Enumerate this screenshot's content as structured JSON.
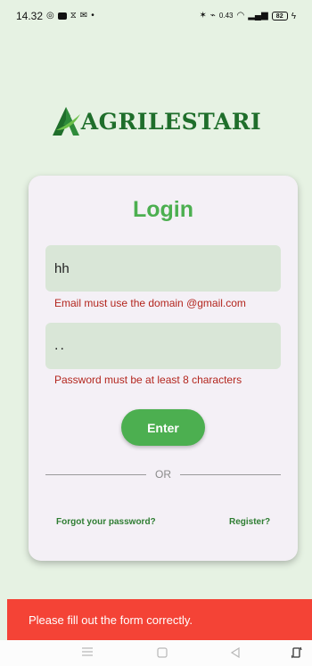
{
  "status_bar": {
    "time": "14.32",
    "net_speed": "0.43",
    "battery": "82"
  },
  "logo": {
    "text": "AGRILESTARI",
    "color": "#1f6e2b",
    "icon": "leaf-a-icon"
  },
  "login": {
    "title": "Login",
    "email_value": "hh",
    "email_error": "Email must use the domain @gmail.com",
    "password_value": "..",
    "password_error": "Password must be at least 8 characters",
    "enter_label": "Enter",
    "divider_text": "OR",
    "forgot_label": "Forgot your password?",
    "register_label": "Register?"
  },
  "snackbar": {
    "message": "Please fill out the form correctly.",
    "color": "#f44336"
  },
  "colors": {
    "background": "#e6f2e3",
    "accent": "#4caf50",
    "error": "#b3261e",
    "field_bg": "#d9e6d7"
  }
}
